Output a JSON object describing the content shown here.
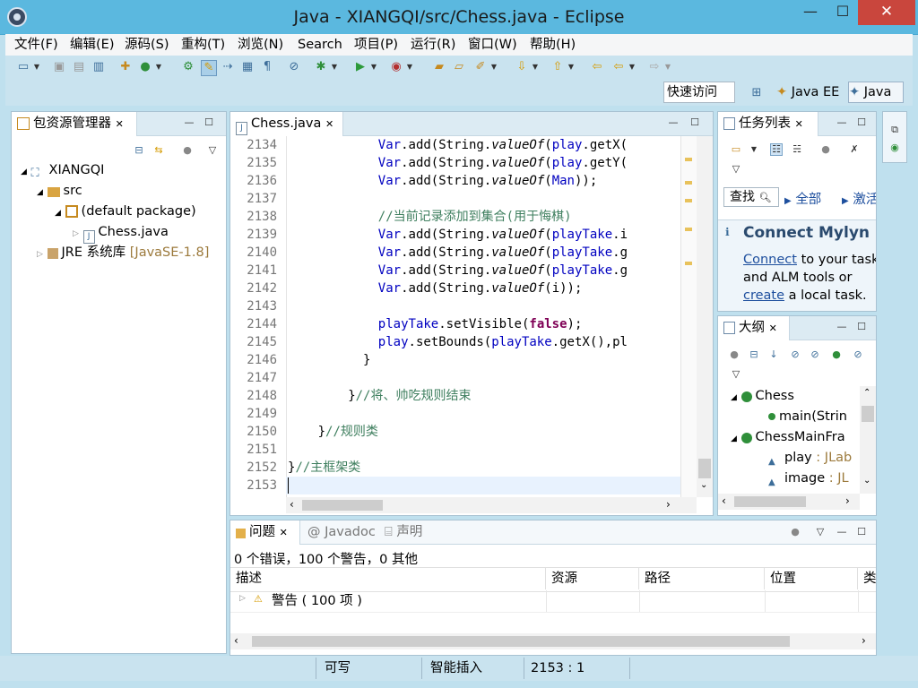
{
  "window": {
    "title": "Java - XIANGQI/src/Chess.java - Eclipse",
    "minimize": "—",
    "maximize": "☐",
    "close": "✕"
  },
  "menu": [
    "文件(F)",
    "编辑(E)",
    "源码(S)",
    "重构(T)",
    "浏览(N)",
    "Search",
    "项目(P)",
    "运行(R)",
    "窗口(W)",
    "帮助(H)"
  ],
  "toolbar": {
    "quick_access": "快速访问",
    "perspectives": [
      "Java EE",
      "Java"
    ]
  },
  "package_explorer": {
    "tab": "包资源管理器",
    "tree": [
      {
        "label": "XIANGQI",
        "depth": 0
      },
      {
        "label": "src",
        "depth": 1
      },
      {
        "label": "(default package)",
        "depth": 2
      },
      {
        "label": "Chess.java",
        "depth": 3
      },
      {
        "label": "JRE 系统库",
        "suffix": "[JavaSE-1.8]",
        "depth": 0
      }
    ]
  },
  "editor": {
    "tab": "Chess.java",
    "lines": [
      {
        "n": "2134",
        "code": "Var.add(String.valueOf(play.getX("
      },
      {
        "n": "2135",
        "code": "Var.add(String.valueOf(play.getY("
      },
      {
        "n": "2136",
        "code": "Var.add(String.valueOf(Man));"
      },
      {
        "n": "2137",
        "code": ""
      },
      {
        "n": "2138",
        "code": "//当前记录添加到集合(用于悔棋)"
      },
      {
        "n": "2139",
        "code": "Var.add(String.valueOf(playTake.i"
      },
      {
        "n": "2140",
        "code": "Var.add(String.valueOf(playTake.g"
      },
      {
        "n": "2141",
        "code": "Var.add(String.valueOf(playTake.g"
      },
      {
        "n": "2142",
        "code": "Var.add(String.valueOf(i));"
      },
      {
        "n": "2143",
        "code": ""
      },
      {
        "n": "2144",
        "code": "playTake.setVisible(false);"
      },
      {
        "n": "2145",
        "code": "play.setBounds(playTake.getX(),pl"
      },
      {
        "n": "2146",
        "code": "}"
      },
      {
        "n": "2147",
        "code": ""
      },
      {
        "n": "2148",
        "code": "}//将、帅吃规则结束"
      },
      {
        "n": "2149",
        "code": ""
      },
      {
        "n": "2150",
        "code": "}//规则类"
      },
      {
        "n": "2151",
        "code": ""
      },
      {
        "n": "2152",
        "code": "}//主框架类"
      },
      {
        "n": "2153",
        "code": ""
      }
    ]
  },
  "tasks": {
    "tab": "任务列表",
    "find_placeholder": "查找",
    "all": "全部",
    "activate": "激活",
    "mylyn_title": "Connect Mylyn",
    "mylyn_connect": "Connect",
    "mylyn_text1": " to your task",
    "mylyn_text2": "and ALM tools or",
    "mylyn_create": "create",
    "mylyn_text3": " a local task."
  },
  "outline": {
    "tab": "大纲",
    "items": [
      {
        "label": "Chess",
        "suffix": ""
      },
      {
        "label": "main(Strin",
        "suffix": ""
      },
      {
        "label": "ChessMainFra",
        "suffix": ""
      },
      {
        "label": "play",
        "suffix": " : JLab"
      },
      {
        "label": "image",
        "suffix": " : JL"
      }
    ]
  },
  "problems": {
    "tabs": [
      "问题",
      "Javadoc",
      "声明"
    ],
    "summary": "0 个错误，100 个警告，0 其他",
    "columns": [
      "描述",
      "资源",
      "路径",
      "位置",
      "类"
    ],
    "rows": [
      {
        "desc": "警告 ( 100 项 )"
      }
    ]
  },
  "status": {
    "writable": "可写",
    "insert_mode": "智能插入",
    "position": "2153 : 1"
  }
}
